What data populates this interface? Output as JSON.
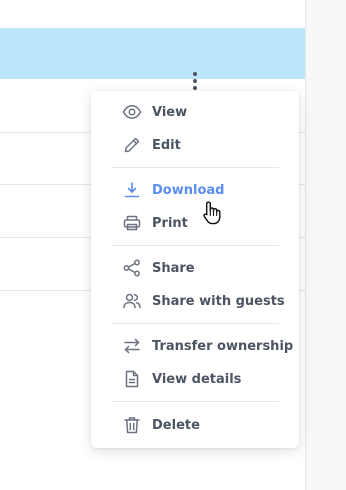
{
  "menu": {
    "items": [
      {
        "label": "View",
        "icon": "eye-icon"
      },
      {
        "label": "Edit",
        "icon": "pencil-icon"
      },
      {
        "label": "Download",
        "icon": "download-icon",
        "highlighted": true
      },
      {
        "label": "Print",
        "icon": "printer-icon"
      },
      {
        "label": "Share",
        "icon": "share-icon"
      },
      {
        "label": "Share with guests",
        "icon": "users-icon"
      },
      {
        "label": "Transfer ownership",
        "icon": "transfer-icon"
      },
      {
        "label": "View details",
        "icon": "document-icon"
      },
      {
        "label": "Delete",
        "icon": "trash-icon"
      }
    ]
  },
  "colors": {
    "selected_row": "#bde5fb",
    "highlight": "#5b8def",
    "menu_text": "#4b5563"
  }
}
